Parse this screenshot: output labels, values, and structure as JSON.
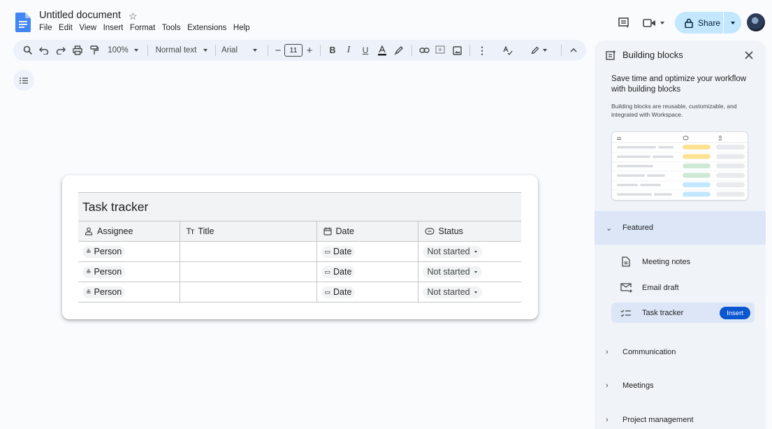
{
  "document": {
    "title": "Untitled document",
    "menu": [
      "File",
      "Edit",
      "View",
      "Insert",
      "Format",
      "Tools",
      "Extensions",
      "Help"
    ]
  },
  "header": {
    "share_label": "Share"
  },
  "toolbar": {
    "zoom": "100%",
    "style": "Normal text",
    "font": "Arial",
    "font_size": "11"
  },
  "task_tracker": {
    "title": "Task tracker",
    "columns": [
      {
        "label": "Assignee",
        "icon": "person-icon"
      },
      {
        "label": "Title",
        "icon": "text-icon"
      },
      {
        "label": "Date",
        "icon": "calendar-icon"
      },
      {
        "label": "Status",
        "icon": "status-icon"
      }
    ],
    "rows": [
      {
        "assignee": "Person",
        "title": "",
        "date": "Date",
        "status": "Not started"
      },
      {
        "assignee": "Person",
        "title": "",
        "date": "Date",
        "status": "Not started"
      },
      {
        "assignee": "Person",
        "title": "",
        "date": "Date",
        "status": "Not started"
      }
    ]
  },
  "panel": {
    "title": "Building blocks",
    "heading": "Save time and optimize your workflow with building blocks",
    "description": "Building blocks are reusable, customizable, and integrated with Workspace.",
    "featured_label": "Featured",
    "featured_items": [
      {
        "label": "Meeting notes",
        "icon": "document-icon"
      },
      {
        "label": "Email draft",
        "icon": "email-icon"
      },
      {
        "label": "Task tracker",
        "icon": "checklist-icon"
      }
    ],
    "insert_label": "Insert",
    "sections": [
      "Communication",
      "Meetings",
      "Project management"
    ],
    "accent_color": "#0b57d0"
  }
}
